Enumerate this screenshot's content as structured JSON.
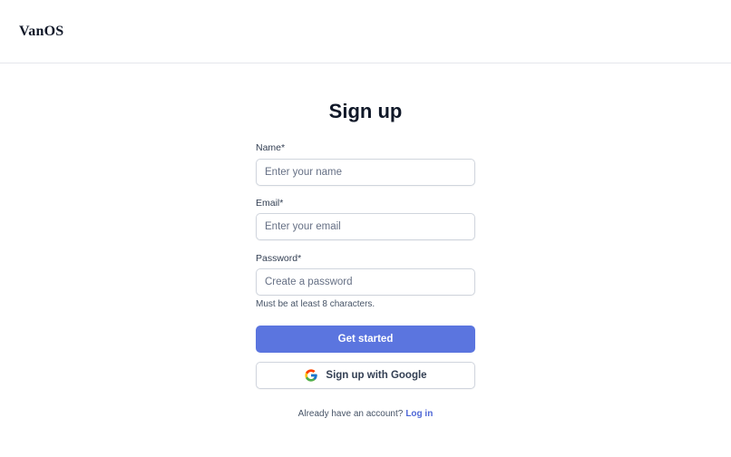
{
  "header": {
    "logo": "VanOS"
  },
  "main": {
    "title": "Sign up"
  },
  "form": {
    "name": {
      "label": "Name*",
      "placeholder": "Enter your name"
    },
    "email": {
      "label": "Email*",
      "placeholder": "Enter your email"
    },
    "password": {
      "label": "Password*",
      "placeholder": "Create a password",
      "hint": "Must be at least 8 characters."
    },
    "submit_label": "Get started",
    "google_label": "Sign up with Google",
    "google_icon": "google-icon"
  },
  "footer": {
    "prompt": "Already have an account?",
    "login_link": "Log in"
  },
  "colors": {
    "primary": "#5b75df",
    "link": "#4e67d6",
    "border": "#d0d5dd"
  }
}
